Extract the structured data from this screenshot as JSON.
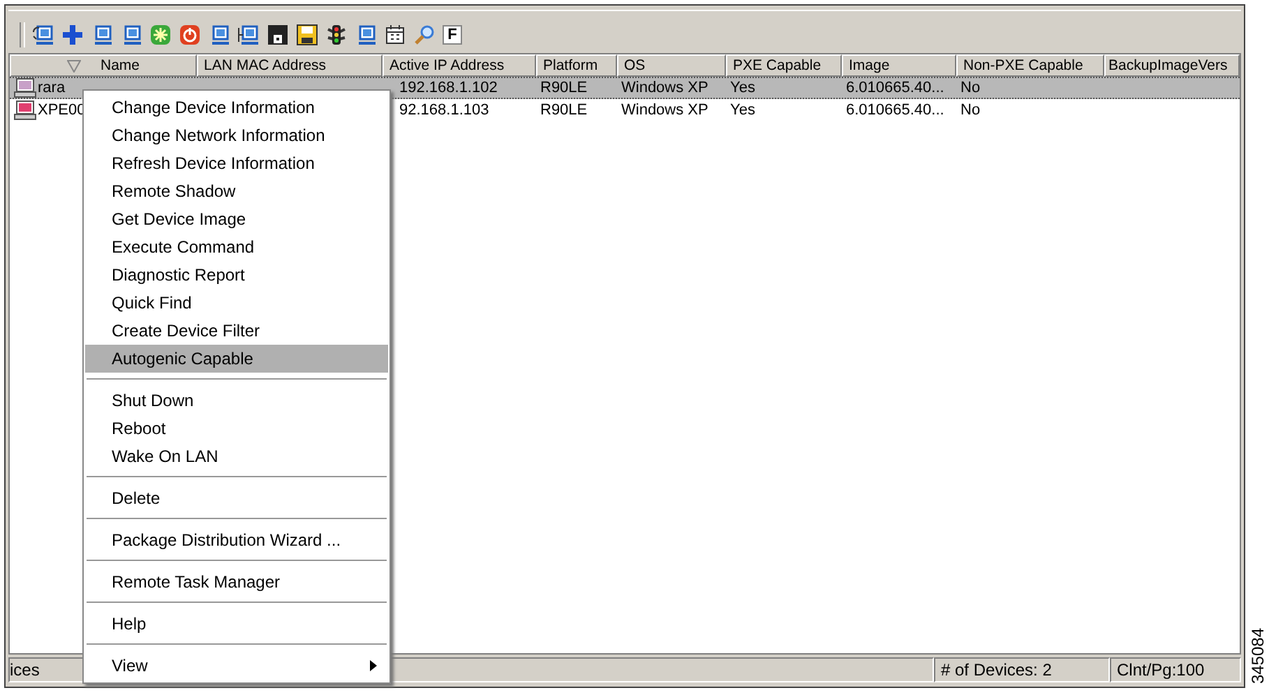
{
  "toolbar": {
    "text_button": "F"
  },
  "table": {
    "columns": [
      "Name",
      "LAN MAC Address",
      "Active IP Address",
      "Platform",
      "OS",
      "PXE Capable",
      "Image",
      "Non-PXE Capable",
      "BackupImageVers"
    ],
    "rows": [
      {
        "selected": true,
        "name": "rara",
        "ip": "192.168.1.102",
        "platform": "R90LE",
        "os": "Windows XP",
        "pxe": "Yes",
        "image": "6.010665.40...",
        "non_pxe": "No"
      },
      {
        "selected": false,
        "name": "XPE00",
        "ip": "92.168.1.103",
        "platform": "R90LE",
        "os": "Windows XP",
        "pxe": "Yes",
        "image": "6.010665.40...",
        "non_pxe": "No"
      }
    ]
  },
  "context_menu": {
    "items": [
      {
        "kind": "item",
        "label": "Change Device Information",
        "selected": false
      },
      {
        "kind": "item",
        "label": "Change Network Information",
        "selected": false
      },
      {
        "kind": "item",
        "label": "Refresh Device Information",
        "selected": false
      },
      {
        "kind": "item",
        "label": "Remote Shadow",
        "selected": false
      },
      {
        "kind": "item",
        "label": "Get Device Image",
        "selected": false
      },
      {
        "kind": "item",
        "label": "Execute Command",
        "selected": false
      },
      {
        "kind": "item",
        "label": "Diagnostic Report",
        "selected": false
      },
      {
        "kind": "item",
        "label": "Quick Find",
        "selected": false
      },
      {
        "kind": "item",
        "label": "Create Device Filter",
        "selected": false
      },
      {
        "kind": "item",
        "label": "Autogenic Capable",
        "selected": true
      },
      {
        "kind": "separator"
      },
      {
        "kind": "item",
        "label": "Shut Down",
        "selected": false
      },
      {
        "kind": "item",
        "label": "Reboot",
        "selected": false
      },
      {
        "kind": "item",
        "label": "Wake On LAN",
        "selected": false
      },
      {
        "kind": "separator"
      },
      {
        "kind": "item",
        "label": "Delete",
        "selected": false
      },
      {
        "kind": "separator"
      },
      {
        "kind": "item",
        "label": "Package Distribution Wizard ...",
        "selected": false
      },
      {
        "kind": "separator"
      },
      {
        "kind": "item",
        "label": "Remote Task Manager",
        "selected": false
      },
      {
        "kind": "separator"
      },
      {
        "kind": "item",
        "label": "Help",
        "selected": false
      },
      {
        "kind": "separator"
      },
      {
        "kind": "item",
        "label": "View",
        "selected": false,
        "submenu": true
      }
    ]
  },
  "status_bar": {
    "left": "ices",
    "device_count": "# of Devices: 2",
    "client_page": "Clnt/Pg:100"
  },
  "figure_id": "345084"
}
